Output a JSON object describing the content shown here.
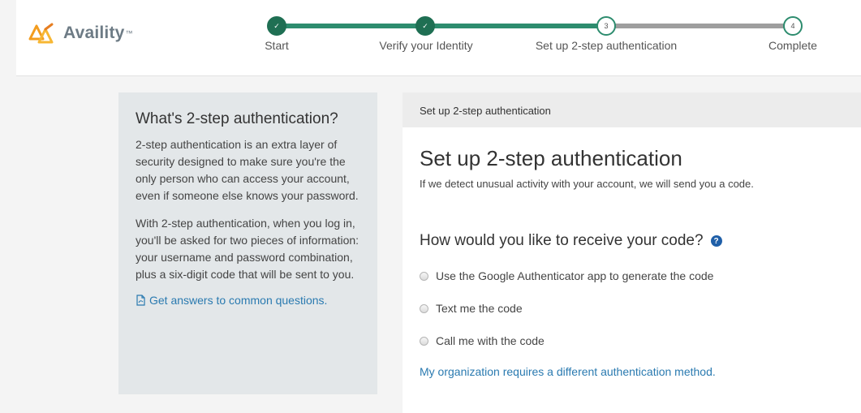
{
  "brand": {
    "name": "Availity",
    "tm": "™"
  },
  "progress": {
    "steps": [
      {
        "label": "Start",
        "marker": "✓"
      },
      {
        "label": "Verify your Identity",
        "marker": "✓"
      },
      {
        "label": "Set up 2-step authentication",
        "marker": "3"
      },
      {
        "label": "Complete",
        "marker": "4"
      }
    ]
  },
  "sidebar": {
    "title": "What's 2-step authentication?",
    "para1": "2-step authentication is an extra layer of security designed to make sure you're the only person who can access your account, even if someone else knows your password.",
    "para2": "With 2-step authentication, when you log in, you'll be asked for two pieces of information: your username and password combination, plus a six-digit code that will be sent to you.",
    "link": "Get answers to common questions."
  },
  "main": {
    "header": "Set up 2-step authentication",
    "title": "Set up 2-step authentication",
    "subtitle": "If we detect unusual activity with your account, we will send you a code.",
    "question": "How would you like to receive your code?",
    "help": "?",
    "options": [
      "Use the Google Authenticator app to generate the code",
      "Text me the code",
      "Call me with the code"
    ],
    "alt_link": "My organization requires a different authentication method."
  },
  "colors": {
    "accent": "#2d8c6e",
    "link": "#2a7ab0",
    "help": "#1f5fa8"
  }
}
